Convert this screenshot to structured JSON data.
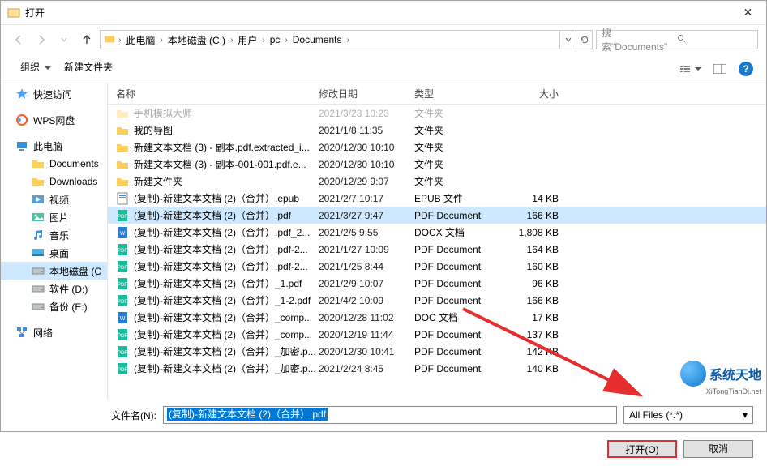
{
  "title": "打开",
  "breadcrumb": [
    "此电脑",
    "本地磁盘 (C:)",
    "用户",
    "pc",
    "Documents"
  ],
  "search_placeholder": "搜索\"Documents\"",
  "toolbar": {
    "organize": "组织",
    "newfolder": "新建文件夹"
  },
  "columns": {
    "name": "名称",
    "date": "修改日期",
    "type": "类型",
    "size": "大小"
  },
  "sidebar": [
    {
      "label": "快速访问",
      "icon": "star",
      "sub": false
    },
    {
      "label": "WPS网盘",
      "icon": "wps",
      "sub": false
    },
    {
      "label": "此电脑",
      "icon": "pc",
      "sub": false
    },
    {
      "label": "Documents",
      "icon": "folder",
      "sub": true
    },
    {
      "label": "Downloads",
      "icon": "folder",
      "sub": true
    },
    {
      "label": "视频",
      "icon": "video",
      "sub": true
    },
    {
      "label": "图片",
      "icon": "picture",
      "sub": true
    },
    {
      "label": "音乐",
      "icon": "music",
      "sub": true
    },
    {
      "label": "桌面",
      "icon": "desktop",
      "sub": true
    },
    {
      "label": "本地磁盘 (C",
      "icon": "disk",
      "sub": true,
      "sel": true
    },
    {
      "label": "软件 (D:)",
      "icon": "disk",
      "sub": true
    },
    {
      "label": "备份 (E:)",
      "icon": "disk",
      "sub": true
    },
    {
      "label": "网络",
      "icon": "network",
      "sub": false
    }
  ],
  "files": [
    {
      "icon": "folder",
      "name": "手机模拟大师",
      "date": "2021/3/23 10:23",
      "type": "文件夹",
      "size": "",
      "faded": true
    },
    {
      "icon": "folder",
      "name": "我的导图",
      "date": "2021/1/8 11:35",
      "type": "文件夹",
      "size": ""
    },
    {
      "icon": "folder",
      "name": "新建文本文档 (3) - 副本.pdf.extracted_i...",
      "date": "2020/12/30 10:10",
      "type": "文件夹",
      "size": ""
    },
    {
      "icon": "folder",
      "name": "新建文本文档 (3) - 副本-001-001.pdf.e...",
      "date": "2020/12/30 10:10",
      "type": "文件夹",
      "size": ""
    },
    {
      "icon": "folder",
      "name": "新建文件夹",
      "date": "2020/12/29 9:07",
      "type": "文件夹",
      "size": ""
    },
    {
      "icon": "epub",
      "name": "(复制)-新建文本文档 (2)（合并）.epub",
      "date": "2021/2/7 10:17",
      "type": "EPUB 文件",
      "size": "14 KB"
    },
    {
      "icon": "pdf",
      "name": "(复制)-新建文本文档 (2)（合并）.pdf",
      "date": "2021/3/27 9:47",
      "type": "PDF Document",
      "size": "166 KB",
      "sel": true
    },
    {
      "icon": "docx",
      "name": "(复制)-新建文本文档 (2)（合并）.pdf_2...",
      "date": "2021/2/5 9:55",
      "type": "DOCX 文档",
      "size": "1,808 KB"
    },
    {
      "icon": "pdf",
      "name": "(复制)-新建文本文档 (2)（合并）.pdf-2...",
      "date": "2021/1/27 10:09",
      "type": "PDF Document",
      "size": "164 KB"
    },
    {
      "icon": "pdf",
      "name": "(复制)-新建文本文档 (2)（合并）.pdf-2...",
      "date": "2021/1/25 8:44",
      "type": "PDF Document",
      "size": "160 KB"
    },
    {
      "icon": "pdf",
      "name": "(复制)-新建文本文档 (2)（合并）_1.pdf",
      "date": "2021/2/9 10:07",
      "type": "PDF Document",
      "size": "96 KB"
    },
    {
      "icon": "pdf",
      "name": "(复制)-新建文本文档 (2)（合并）_1-2.pdf",
      "date": "2021/4/2 10:09",
      "type": "PDF Document",
      "size": "166 KB"
    },
    {
      "icon": "doc",
      "name": "(复制)-新建文本文档 (2)（合并）_comp...",
      "date": "2020/12/28 11:02",
      "type": "DOC 文档",
      "size": "17 KB"
    },
    {
      "icon": "pdf",
      "name": "(复制)-新建文本文档 (2)（合并）_comp...",
      "date": "2020/12/19 11:44",
      "type": "PDF Document",
      "size": "137 KB"
    },
    {
      "icon": "pdf",
      "name": "(复制)-新建文本文档 (2)（合并）_加密.p...",
      "date": "2020/12/30 10:41",
      "type": "PDF Document",
      "size": "142 KB"
    },
    {
      "icon": "pdf",
      "name": "(复制)-新建文本文档 (2)（合并）_加密.p...",
      "date": "2021/2/24 8:45",
      "type": "PDF Document",
      "size": "140 KB"
    }
  ],
  "filename_label": "文件名(N):",
  "filename_value": "(复制)-新建文本文档 (2)（合并）.pdf",
  "filetype": "All Files (*.*)",
  "buttons": {
    "open": "打开(O)",
    "cancel": "取消"
  },
  "watermark": {
    "text": "系统天地",
    "sub": "XiTongTianDi.net"
  }
}
